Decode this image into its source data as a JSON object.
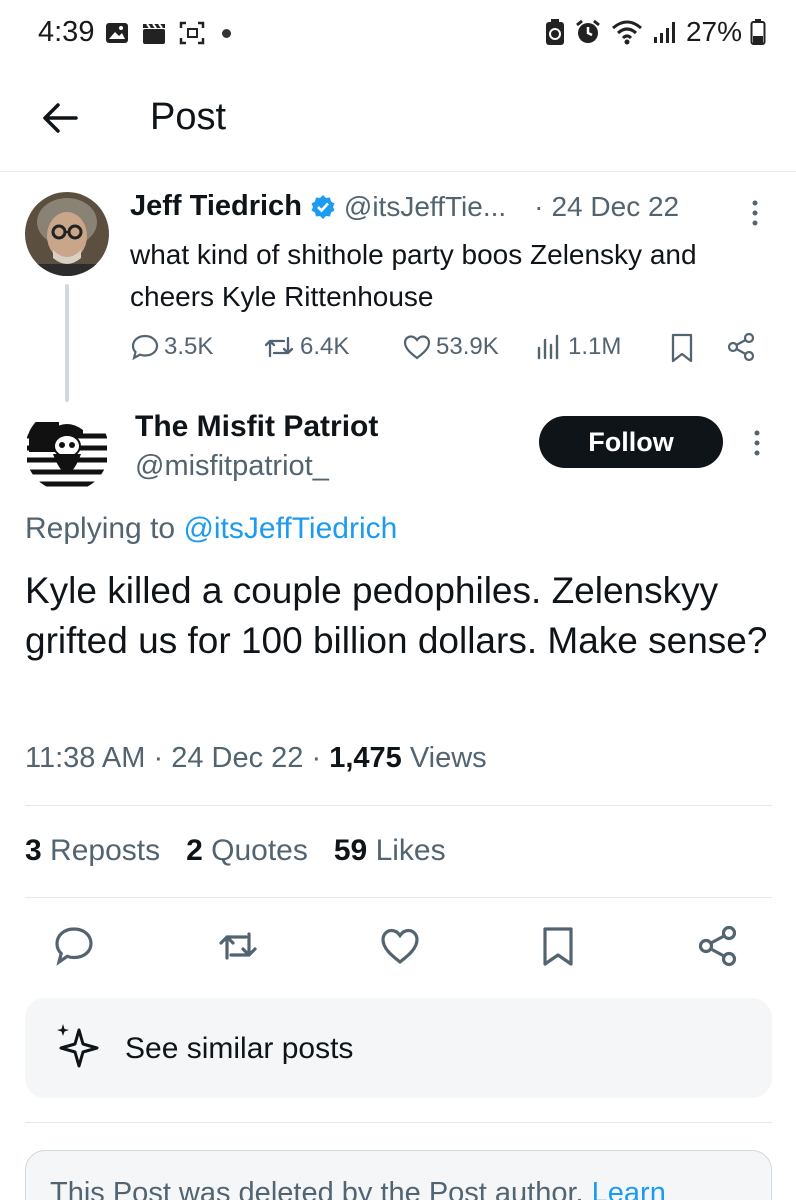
{
  "status_bar": {
    "time": "4:39",
    "battery": "27%"
  },
  "header": {
    "title": "Post"
  },
  "parent_post": {
    "author_name": "Jeff Tiedrich",
    "handle": "@itsJeffTie...",
    "separator": "·",
    "date": "24 Dec 22",
    "text": "what kind of shithole party boos Zelensky and cheers Kyle Rittenhouse",
    "replies": "3.5K",
    "reposts": "6.4K",
    "likes": "53.9K",
    "views": "1.1M"
  },
  "main_post": {
    "author_name": "The Misfit Patriot",
    "handle": "@misfitpatriot_",
    "follow_label": "Follow",
    "replying_prefix": "Replying to ",
    "replying_to": "@itsJeffTiedrich",
    "text": "Kyle killed a couple pedophiles. Zelenskyy grifted us for 100 billion dollars. Make sense?",
    "time": "11:38 AM",
    "dot": "·",
    "date": "24 Dec 22",
    "views_count": "1,475",
    "views_label": "Views",
    "reposts_count": "3",
    "reposts_label": "Reposts",
    "quotes_count": "2",
    "quotes_label": "Quotes",
    "likes_count": "59",
    "likes_label": "Likes"
  },
  "similar": {
    "label": "See similar posts"
  },
  "deleted_notice": {
    "text": "This Post was deleted by the Post author.",
    "link": "Learn"
  },
  "colors": {
    "accent": "#1d9bf0",
    "text": "#0f1419",
    "muted": "#536471",
    "verified": "#1d9bf0"
  },
  "icons": [
    "back-arrow-icon",
    "verified-badge-icon",
    "more-icon",
    "reply-icon",
    "repost-icon",
    "like-icon",
    "views-icon",
    "bookmark-icon",
    "share-icon",
    "sparkle-icon"
  ]
}
